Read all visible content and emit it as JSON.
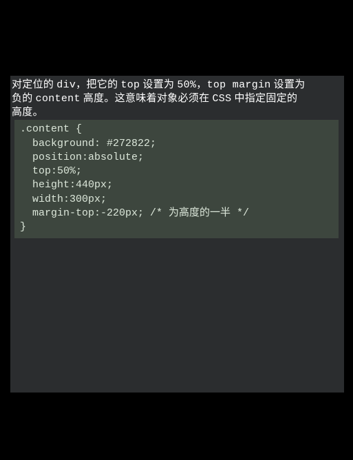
{
  "paragraph": {
    "line1_pre": "对定位的 ",
    "line1_div": "div",
    "line1_mid": "，把它的 ",
    "line1_top": "top",
    "line1_mid2": " 设置为 ",
    "line1_50": "50%",
    "line1_mid3": "，",
    "line1_tm": "top margin",
    "line1_end": " 设置为",
    "line2_pre": "负的 ",
    "line2_content": "content",
    "line2_mid": " 高度。这意味着对象必须在 ",
    "line2_css": "CSS",
    "line2_end": " 中指定固定的",
    "line3": "高度。"
  },
  "code": {
    "l1": ".content {",
    "l2": "  background: #272822;",
    "l3": "  position:absolute;",
    "l4": "  top:50%;",
    "l5": "  height:440px;",
    "l6": "  width:300px;",
    "l7": "  margin-top:-220px; /* 为高度的一半 */",
    "l8": "}"
  }
}
